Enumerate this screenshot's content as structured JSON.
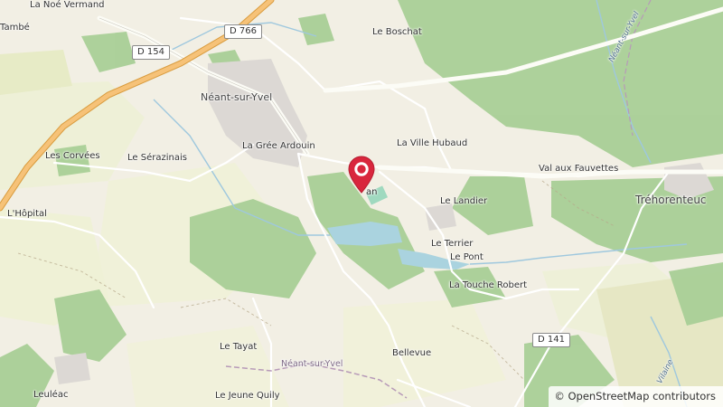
{
  "map": {
    "place_labels": [
      {
        "id": "la-noe-vermand",
        "text": "La Noé Vermand"
      },
      {
        "id": "tambe",
        "text": "També"
      },
      {
        "id": "neant-sur-yvel",
        "text": "Néant-sur-Yvel"
      },
      {
        "id": "le-boschat",
        "text": "Le Boschat"
      },
      {
        "id": "la-gree-ardouin",
        "text": "La Grée Ardouin"
      },
      {
        "id": "la-ville-hubaud",
        "text": "La Ville Hubaud"
      },
      {
        "id": "les-corvees",
        "text": "Les Corvées"
      },
      {
        "id": "le-serazinais",
        "text": "Le Sérazinais"
      },
      {
        "id": "val-aux-fauvettes",
        "text": "Val aux Fauvettes"
      },
      {
        "id": "trehorenteuc",
        "text": "Tréhorenteuc"
      },
      {
        "id": "lhopital",
        "text": "L'Hôpital"
      },
      {
        "id": "le-landier",
        "text": "Le Landier"
      },
      {
        "id": "le-terrier",
        "text": "Le Terrier"
      },
      {
        "id": "le-pont",
        "text": "Le Pont"
      },
      {
        "id": "la-touche-robert",
        "text": "La Touche Robert"
      },
      {
        "id": "le-tayat",
        "text": "Le Tayat"
      },
      {
        "id": "bellevue",
        "text": "Bellevue"
      },
      {
        "id": "leuleac",
        "text": "Leuléac"
      },
      {
        "id": "le-jeune-quily",
        "text": "Le Jeune Quily"
      },
      {
        "id": "partial-an",
        "text": "an"
      }
    ],
    "commune_labels": [
      {
        "id": "commune-neant",
        "text": "Néant-sur-Yvel"
      }
    ],
    "river_labels": [
      {
        "id": "yvel-river-top",
        "text": "Néant-sur-Yvel"
      },
      {
        "id": "vilaine-river",
        "text": "Vilaine"
      }
    ],
    "road_shields": [
      {
        "id": "d766",
        "text": "D 766"
      },
      {
        "id": "d154",
        "text": "D 154"
      },
      {
        "id": "d141",
        "text": "D 141"
      }
    ],
    "marker": {
      "icon": "map-pin-icon",
      "color": "#d9263d"
    },
    "colors": {
      "background": "#f2efe4",
      "forest": "#a8d098",
      "farmland": "#f0f2d8",
      "water": "#aad3df",
      "motorway": "#f3b866",
      "town": "#dcd8d4"
    }
  },
  "attribution": {
    "symbol": "©",
    "link_text": "OpenStreetMap",
    "suffix": "contributors"
  }
}
